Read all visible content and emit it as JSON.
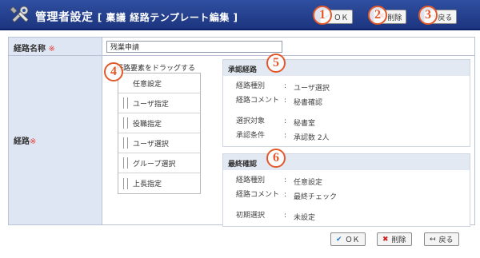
{
  "header": {
    "title": "管理者設定",
    "subtitle": "[ 稟議 経路テンプレート編集 ]",
    "buttons": {
      "ok": "ＯＫ",
      "delete": "削除",
      "back": "戻る"
    },
    "markers": [
      "1",
      "2",
      "3"
    ]
  },
  "form": {
    "route_name_label": "経路名称",
    "route_name_value": "残業申請",
    "route_label": "経路",
    "required_mark": "※",
    "drag_caption": "経路要素をドラッグする",
    "palette_items": [
      "任意設定",
      "ユーザ指定",
      "役職指定",
      "ユーザ選択",
      "グループ選択",
      "上長指定"
    ],
    "markers": {
      "palette": "4",
      "approval": "5",
      "final": "6"
    },
    "approval": {
      "title": "承認経路",
      "rows": [
        {
          "key": "経路種別",
          "sep": ":",
          "value": "ユーザ選択"
        },
        {
          "key": "経路コメント",
          "sep": ":",
          "value": "秘書確認"
        },
        {
          "key": "選択対象",
          "sep": ":",
          "value": "秘書室"
        },
        {
          "key": "承認条件",
          "sep": ":",
          "value": "承認数 2人"
        }
      ]
    },
    "final": {
      "title": "最終確認",
      "rows": [
        {
          "key": "経路種別",
          "sep": ":",
          "value": "任意設定"
        },
        {
          "key": "経路コメント",
          "sep": ":",
          "value": "最終チェック"
        },
        {
          "key": "初期選択",
          "sep": ":",
          "value": "未設定"
        }
      ]
    }
  },
  "footer": {
    "ok": "ＯＫ",
    "delete": "削除",
    "back": "戻る"
  },
  "colors": {
    "header": "#1d3580",
    "label_bg": "#dfe6f3",
    "marker": "#e2582a",
    "panel_title_bg": "#e3e9f3"
  },
  "icons": [
    "tools-icon",
    "check-icon",
    "x-icon",
    "back-arrow-icon",
    "grip-icon"
  ]
}
